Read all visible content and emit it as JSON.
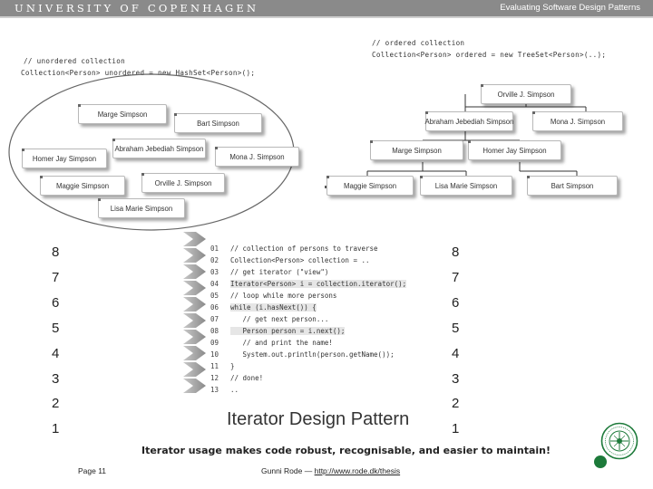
{
  "header": {
    "university": "UNIVERSITY OF COPENHAGEN",
    "course": "Evaluating Software Design Patterns"
  },
  "unordered": {
    "comment": "// unordered collection",
    "decl": "Collection<Person> unordered = new HashSet<Person>();",
    "items": [
      "Marge Simpson",
      "Bart Simpson",
      "Abraham Jebediah Simpson",
      "Homer Jay Simpson",
      "Mona J. Simpson",
      "Maggie Simpson",
      "Orville J. Simpson",
      "Lisa Marie Simpson"
    ]
  },
  "ordered": {
    "comment": "// ordered collection",
    "decl": "Collection<Person> ordered = new TreeSet<Person>(..);",
    "root": "Orville J. Simpson",
    "level1": [
      "Abraham Jebediah Simpson",
      "Mona J. Simpson"
    ],
    "level2": [
      "Marge Simpson",
      "Homer Jay Simpson"
    ],
    "level3": [
      "Maggie Simpson",
      "Lisa Marie Simpson",
      "Bart Simpson"
    ]
  },
  "counters_left": [
    "8",
    "7",
    "6",
    "5",
    "4",
    "3",
    "2",
    "1"
  ],
  "counters_right": [
    "8",
    "7",
    "6",
    "5",
    "4",
    "3",
    "2",
    "1"
  ],
  "code": [
    {
      "ln": "01",
      "text": "// collection of persons to traverse"
    },
    {
      "ln": "02",
      "text": "Collection<Person> collection = .."
    },
    {
      "ln": "03",
      "text": "// get iterator (\"view\")"
    },
    {
      "ln": "04",
      "text": "Iterator<Person> i = collection.iterator();"
    },
    {
      "ln": "05",
      "text": "// loop while more persons"
    },
    {
      "ln": "06",
      "text": "while (i.hasNext()) {"
    },
    {
      "ln": "07",
      "text": "   // get next person..."
    },
    {
      "ln": "08",
      "text": "   Person person = i.next();"
    },
    {
      "ln": "09",
      "text": "   // and print the name!"
    },
    {
      "ln": "10",
      "text": "   System.out.println(person.getName());"
    },
    {
      "ln": "11",
      "text": "}"
    },
    {
      "ln": "12",
      "text": "// done!"
    },
    {
      "ln": "13",
      "text": ".."
    }
  ],
  "title": "Iterator Design Pattern",
  "tagline": "Iterator usage makes code robust, recognisable, and easier to maintain!",
  "footer": {
    "page": "Page 11",
    "author": "Gunni Rode —",
    "link": "http://www.rode.dk/thesis"
  }
}
